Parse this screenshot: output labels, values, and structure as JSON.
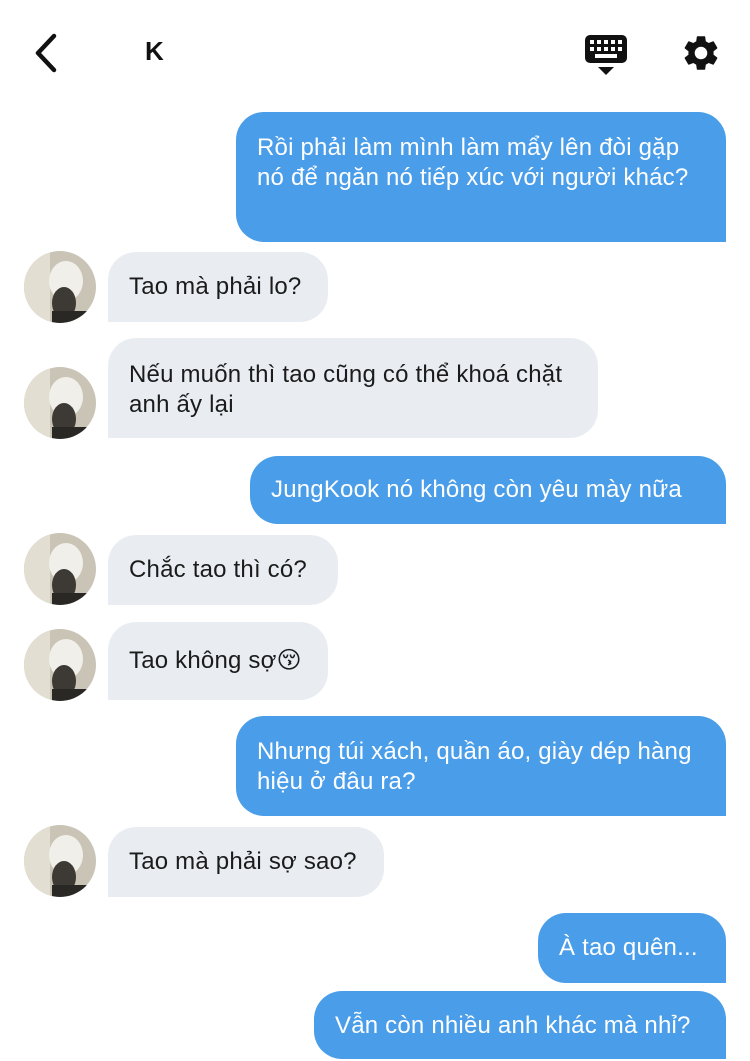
{
  "header": {
    "title": "K",
    "back_icon": "chevron-left-icon",
    "keyboard_icon": "keyboard-icon",
    "settings_icon": "gear-icon"
  },
  "colors": {
    "outgoing_bubble": "#4a9de8",
    "incoming_bubble": "#e9edf2",
    "background": "#ffffff"
  },
  "messages": [
    {
      "direction": "out",
      "text": "Rồi phải làm mình làm mẩy lên đòi gặp nó để ngăn nó tiếp xúc với người khác?"
    },
    {
      "direction": "in",
      "text": "Tao mà phải lo?"
    },
    {
      "direction": "in",
      "text": "Nếu muốn thì tao cũng có thể khoá chặt anh ấy lại"
    },
    {
      "direction": "out",
      "text": "JungKook nó không còn yêu mày nữa"
    },
    {
      "direction": "in",
      "text": "Chắc tao thì có?"
    },
    {
      "direction": "in",
      "text": "Tao không sợ😚"
    },
    {
      "direction": "out",
      "text": "Nhưng túi xách, quần áo, giày dép hàng hiệu ở đâu ra?"
    },
    {
      "direction": "in",
      "text": "Tao mà phải sợ sao?"
    },
    {
      "direction": "out",
      "text": "À tao quên..."
    },
    {
      "direction": "out",
      "text": "Vẫn còn nhiều anh khác mà nhỉ?"
    }
  ]
}
